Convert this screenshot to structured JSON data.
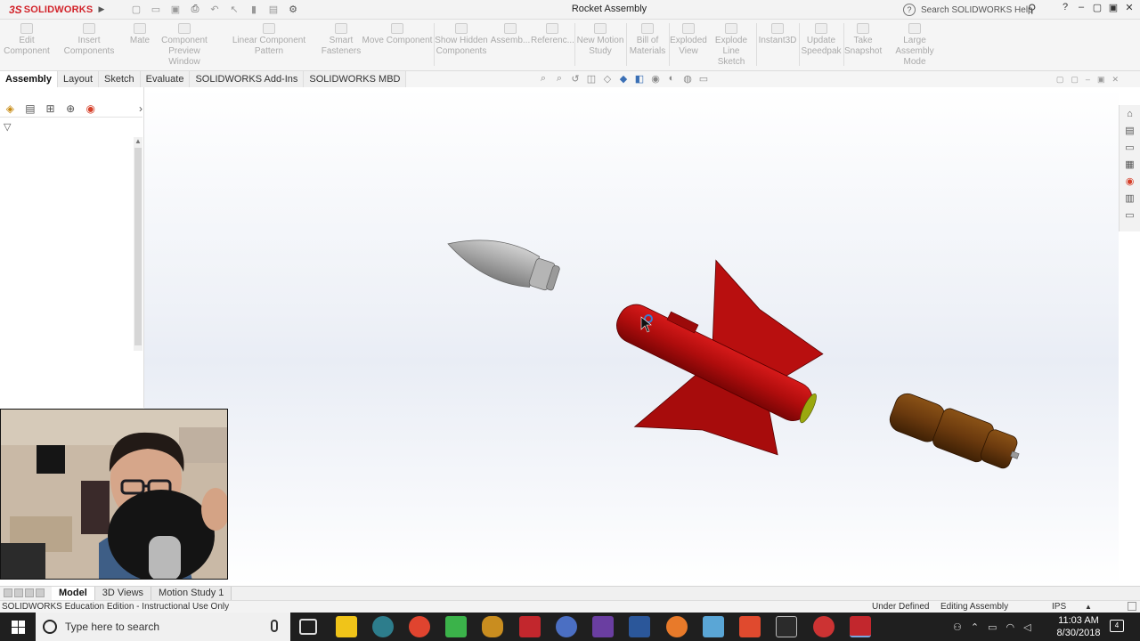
{
  "titlebar": {
    "app_name": "SOLIDWORKS",
    "document_title": "Rocket Assembly",
    "search_placeholder": "Search SOLIDWORKS Help"
  },
  "command_manager": {
    "items": [
      {
        "label_1": "Edit",
        "label_2": "Component"
      },
      {
        "label_1": "Insert Components",
        "label_2": ""
      },
      {
        "label_1": "Mate",
        "label_2": ""
      },
      {
        "label_1": "Component",
        "label_2": "Preview Window"
      },
      {
        "label_1": "Linear Component Pattern",
        "label_2": ""
      },
      {
        "label_1": "Smart",
        "label_2": "Fasteners"
      },
      {
        "label_1": "Move Component",
        "label_2": ""
      },
      {
        "label_1": "Show Hidden",
        "label_2": "Components"
      },
      {
        "label_1": "Assemb...",
        "label_2": ""
      },
      {
        "label_1": "Referenc...",
        "label_2": ""
      },
      {
        "label_1": "New Motion",
        "label_2": "Study"
      },
      {
        "label_1": "Bill of",
        "label_2": "Materials"
      },
      {
        "label_1": "Exploded",
        "label_2": "View"
      },
      {
        "label_1": "Explode",
        "label_2": "Line Sketch"
      },
      {
        "label_1": "Instant3D",
        "label_2": ""
      },
      {
        "label_1": "Update",
        "label_2": "Speedpak"
      },
      {
        "label_1": "Take",
        "label_2": "Snapshot"
      },
      {
        "label_1": "Large Assembly",
        "label_2": "Mode"
      }
    ]
  },
  "tabs": [
    "Assembly",
    "Layout",
    "Sketch",
    "Evaluate",
    "SOLIDWORKS Add-Ins",
    "SOLIDWORKS MBD"
  ],
  "active_tab": "Assembly",
  "bottom_tabs": [
    "Model",
    "3D Views",
    "Motion Study 1"
  ],
  "active_bottom_tab": "Model",
  "status": {
    "edition": "SOLIDWORKS Education Edition - Instructional Use Only",
    "definition": "Under Defined",
    "mode": "Editing Assembly",
    "units": "IPS"
  },
  "taskbar": {
    "search_placeholder": "Type here to search",
    "time": "11:03 AM",
    "date": "8/30/2018",
    "notification_count": "4"
  },
  "colors": {
    "brand_red": "#d2232a",
    "body_red": "#b00d0d",
    "nose_gray": "#a9a9a9",
    "motor_brown": "#6b3a0e",
    "taskbar_bg": "#1f1f1f"
  }
}
